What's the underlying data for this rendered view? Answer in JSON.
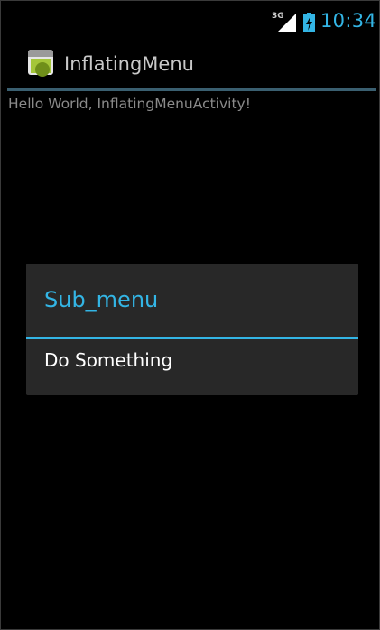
{
  "status_bar": {
    "network_type": "3G",
    "time": "10:34",
    "icons": [
      "signal-icon",
      "battery-charging-icon"
    ],
    "accent_color": "#33b5e5"
  },
  "action_bar": {
    "title": "InflatingMenu",
    "icon": "app-launcher-icon"
  },
  "content": {
    "text": "Hello World, InflatingMenuActivity!"
  },
  "dialog": {
    "title": "Sub_menu",
    "items": [
      {
        "label": "Do Something"
      }
    ],
    "accent_color": "#33b5e5"
  }
}
